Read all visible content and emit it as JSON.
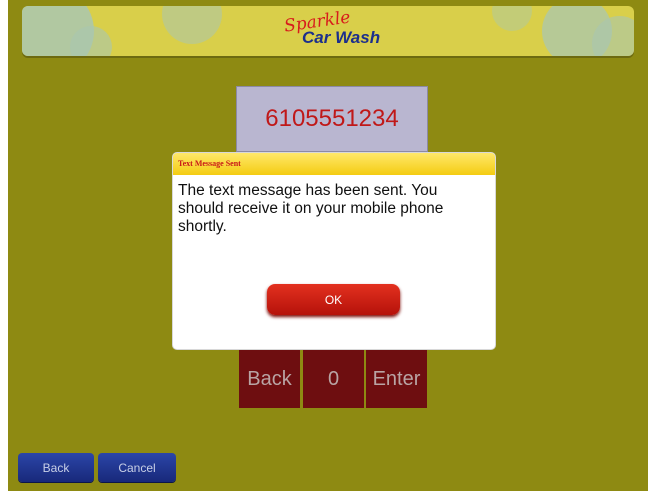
{
  "header": {
    "logo_script": "Sparkle",
    "logo_main": "Car Wash"
  },
  "phone_display": {
    "value": "6105551234"
  },
  "keypad": {
    "back_label": "Back",
    "zero_label": "0",
    "enter_label": "Enter"
  },
  "dialog": {
    "title": "Text Message Sent",
    "message": "The text message has been sent. You should receive it on your mobile phone shortly.",
    "ok_label": "OK"
  },
  "footer": {
    "back_label": "Back",
    "cancel_label": "Cancel"
  },
  "colors": {
    "background": "#8e8a12",
    "keypad": "#6e0e10",
    "dialog_title_bar": "#f4cc12",
    "ok_button": "#c81f12",
    "nav_button": "#1f3590",
    "phone_digits": "#c01818"
  }
}
